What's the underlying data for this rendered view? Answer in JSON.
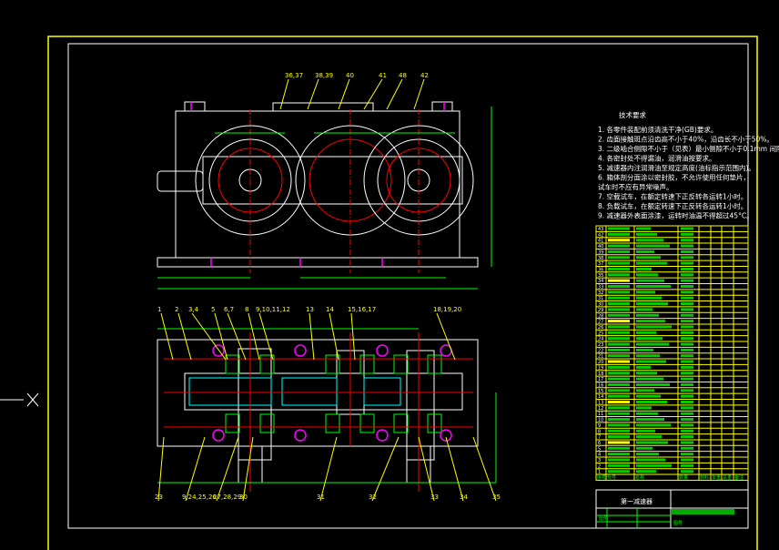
{
  "drawing": {
    "notes": {
      "title": "技术要求",
      "items": [
        "1. 各零件装配前须清洗干净(GB)要求。",
        "2. 齿面接触斑点沿齿高不小于40%，沿齿长不小于50%。",
        "3. 二级啮合侧隙不小于（见表）最小侧隙不小于0.1mm 间隙。",
        "4. 各密封处不得漏油，润滑油按要求。",
        "5. 减速器内注润滑油至规定高度(油标指示范围内)。",
        "6. 箱体剖分面涂以密封胶，不允许使用任何垫片，",
        "   试车时不应有异常噪声。",
        "7. 空载试车，在额定转速下正反转各运转1小时。",
        "8. 负载试车，在额定转速下正反转各运转1小时。",
        "9. 减速器外表面涂漆，运转时油温不得超过45°C。"
      ]
    },
    "top_view_labels": [
      "36,37",
      "38,39",
      "40",
      "41",
      "48",
      "42"
    ],
    "front_view_labels": [
      "1",
      "2",
      "3,4",
      "5",
      "6,7",
      "8",
      "9,10,11,12",
      "13",
      "14",
      "15,16,17",
      "18,19,20"
    ],
    "bottom_labels": [
      "23",
      "9,24,25,26",
      "27,28,29",
      "30",
      "31",
      "32",
      "33",
      "34",
      "35"
    ],
    "parts_list": {
      "row_numbers": [
        "43",
        "42",
        "41",
        "40",
        "39",
        "38",
        "37",
        "36",
        "35",
        "34",
        "33",
        "32",
        "31",
        "30",
        "29",
        "28",
        "27",
        "26",
        "25",
        "24",
        "23",
        "22",
        "21",
        "20",
        "19",
        "18",
        "17",
        "16",
        "15",
        "14",
        "13",
        "12",
        "11",
        "10",
        "9",
        "8",
        "7",
        "6",
        "5",
        "4",
        "3",
        "2",
        "1"
      ],
      "header": [
        "序号",
        "代号",
        "名称",
        "数量",
        "材料",
        "单重",
        "总重",
        "备注"
      ]
    },
    "title_block": {
      "title": "第一减速器",
      "scale_label": "比例",
      "sheet_label": "图号"
    },
    "colors": {
      "frame": "#ffff00",
      "outline": "#ffffff",
      "centerline": "#ff0000",
      "dimension": "#00ff00",
      "hatch": "#00ffff",
      "bolt": "#ff00ff"
    }
  }
}
